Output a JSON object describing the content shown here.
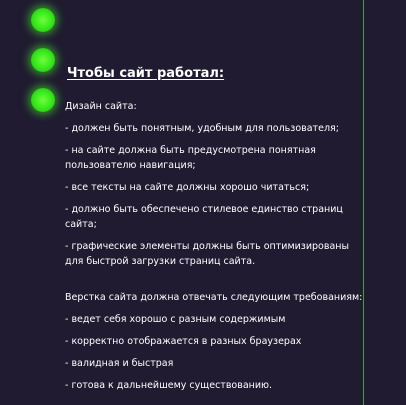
{
  "title": "Чтобы сайт работал:",
  "design_heading": "Дизайн сайта:",
  "design_items": [
    "- должен быть понятным, удобным для пользователя;",
    "- на сайте должна быть предусмотрена понятная пользователю навигация;",
    "- все тексты на сайте должны хорошо читаться;",
    "- должно быть обеспечено стилевое единство страниц сайта;",
    "- графические элементы должны быть оптимизированы для быстрой загрузки страниц сайта."
  ],
  "layout_heading": "Верстка сайта должна отвечать следующим требованиям:",
  "layout_items": [
    "- ведет себя хорошо с разным содержимым",
    "- корректно отображается в разных браузерах",
    "- валидная и быстрая",
    "- готова к дальнейшему существованию."
  ],
  "colors": {
    "background": "#201b31",
    "accent_green": "#35e61a",
    "divider_green": "#3fa33a",
    "text": "#ffffff"
  }
}
